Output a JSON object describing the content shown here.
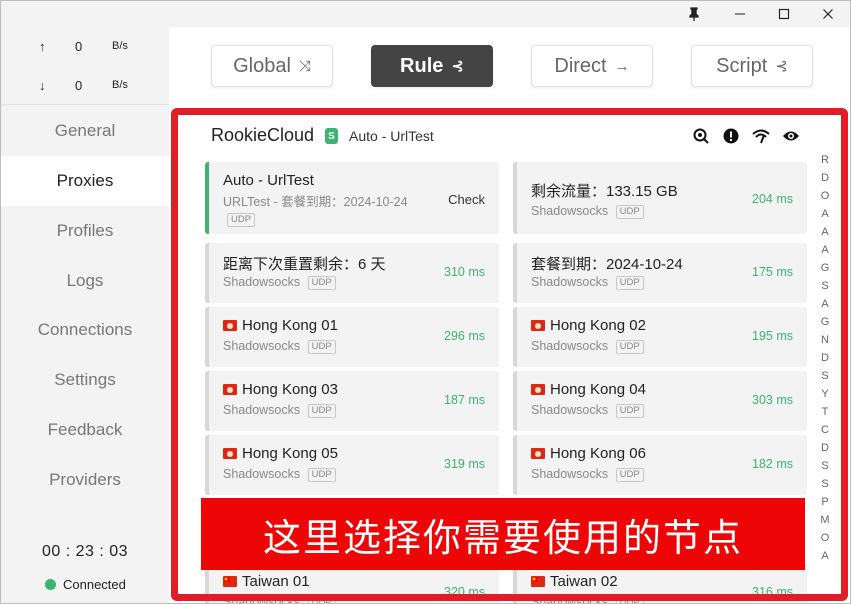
{
  "window_controls": {
    "pin": "pin-icon",
    "minimize": "minimize-icon",
    "maximize": "maximize-icon",
    "close": "close-icon"
  },
  "traffic": {
    "up_arrow": "↑",
    "up_value": "0",
    "up_unit": "B/s",
    "down_arrow": "↓",
    "down_value": "0",
    "down_unit": "B/s"
  },
  "nav": {
    "items": [
      {
        "label": "General"
      },
      {
        "label": "Proxies"
      },
      {
        "label": "Profiles"
      },
      {
        "label": "Logs"
      },
      {
        "label": "Connections"
      },
      {
        "label": "Settings"
      },
      {
        "label": "Feedback"
      },
      {
        "label": "Providers"
      }
    ],
    "active": "Proxies"
  },
  "status": {
    "clock": "00 : 23 : 03",
    "connection": "Connected"
  },
  "modes": {
    "global": "Global",
    "rule": "Rule",
    "direct": "Direct",
    "script": "Script",
    "active": "Rule"
  },
  "group": {
    "name": "RookieCloud",
    "badge": "S",
    "current": "Auto - UrlTest"
  },
  "proxies": [
    {
      "name": "Auto - UrlTest",
      "type": "URLTest - 套餐到期：2024-10-24",
      "udp": "UDP",
      "action": "Check",
      "selected": true
    },
    {
      "name": "剩余流量：133.15 GB",
      "type": "Shadowsocks",
      "udp": "UDP",
      "delay": "204 ms"
    },
    {
      "name": "距离下次重置剩余：6 天",
      "type": "Shadowsocks",
      "udp": "UDP",
      "delay": "310 ms"
    },
    {
      "name": "套餐到期：2024-10-24",
      "type": "Shadowsocks",
      "udp": "UDP",
      "delay": "175 ms"
    },
    {
      "name": "Hong Kong 01",
      "type": "Shadowsocks",
      "udp": "UDP",
      "delay": "296 ms"
    },
    {
      "name": "Hong Kong 02",
      "type": "Shadowsocks",
      "udp": "UDP",
      "delay": "195 ms"
    },
    {
      "name": "Hong Kong 03",
      "type": "Shadowsocks",
      "udp": "UDP",
      "delay": "187 ms"
    },
    {
      "name": "Hong Kong 04",
      "type": "Shadowsocks",
      "udp": "UDP",
      "delay": "303 ms"
    },
    {
      "name": "Hong Kong 05",
      "type": "Shadowsocks",
      "udp": "UDP",
      "delay": "319 ms"
    },
    {
      "name": "Hong Kong 06",
      "type": "Shadowsocks",
      "udp": "UDP",
      "delay": "182 ms"
    },
    {
      "name": "Taiwan 01",
      "type": "Shadowsocks",
      "udp": "UDP",
      "delay": "320 ms"
    },
    {
      "name": "Taiwan 02",
      "type": "Shadowsocks",
      "udp": "UDP",
      "delay": "316 ms"
    }
  ],
  "alphabet_index": [
    "R",
    "D",
    "O",
    "A",
    "A",
    "A",
    "G",
    "S",
    "A",
    "G",
    "N",
    "D",
    "S",
    "Y",
    "T",
    "C",
    "D",
    "S",
    "S",
    "P",
    "M",
    "O",
    "A"
  ],
  "annotation": {
    "text": "这里选择你需要使用的节点"
  },
  "colors": {
    "accent": "#3cb371",
    "annotation_red": "#e21d27",
    "active_mode": "#444444"
  }
}
